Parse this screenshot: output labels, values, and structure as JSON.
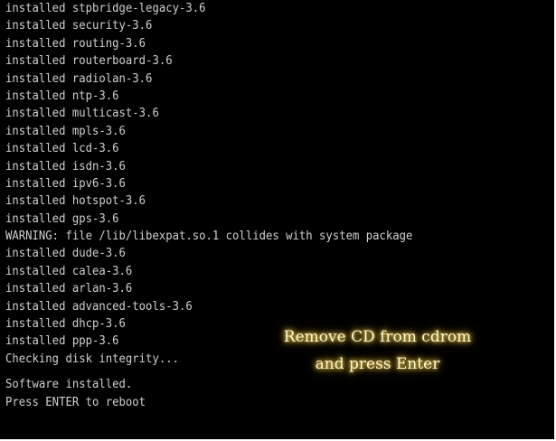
{
  "console": {
    "lines_top": [
      "installed stpbridge-legacy-3.6",
      "installed security-3.6",
      "installed routing-3.6",
      "installed routerboard-3.6",
      "installed radiolan-3.6",
      "installed ntp-3.6",
      "installed multicast-3.6",
      "installed mpls-3.6",
      "installed lcd-3.6",
      "installed isdn-3.6",
      "installed ipv6-3.6",
      "installed hotspot-3.6",
      "installed gps-3.6",
      "WARNING: file /lib/libexpat.so.1 collides with system package",
      "installed dude-3.6",
      "installed calea-3.6",
      "installed arlan-3.6",
      "installed advanced-tools-3.6",
      "installed dhcp-3.6",
      "installed ppp-3.6",
      "Checking disk integrity..."
    ],
    "lines_bottom": [
      "Software installed.",
      "Press ENTER to reboot"
    ]
  },
  "overlay": {
    "line1": "Remove CD from cdrom",
    "line2": "and press Enter",
    "color": "#fff8c8",
    "glow_color": "#e2b838"
  },
  "colors": {
    "background": "#000000",
    "text": "#d0d0d0"
  }
}
